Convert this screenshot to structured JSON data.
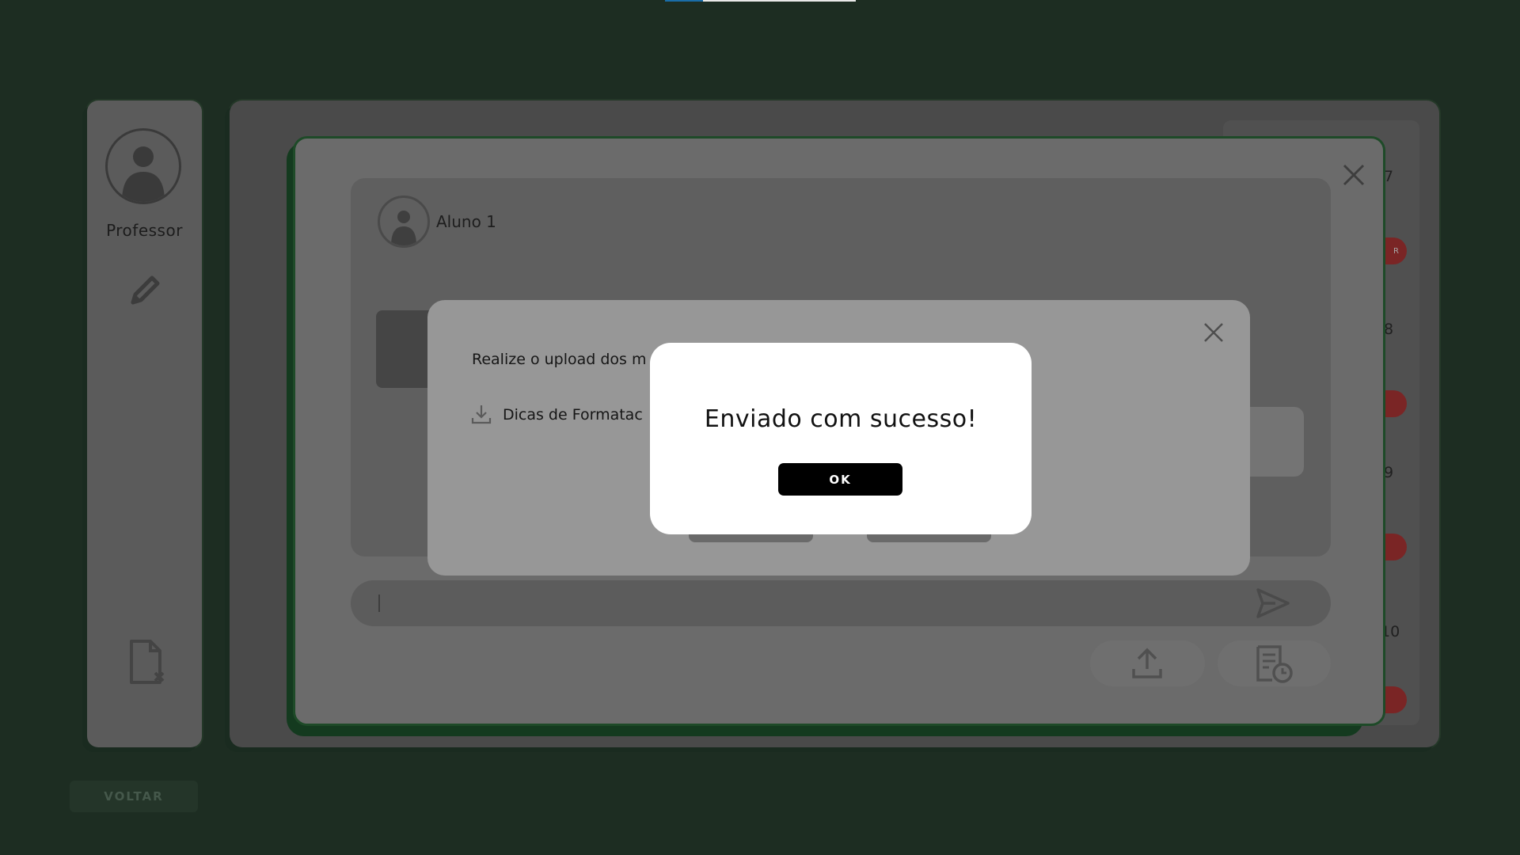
{
  "sidebar": {
    "profile_label": "Professor",
    "icons": [
      "user-avatar-icon",
      "pencil-icon",
      "document-icon"
    ]
  },
  "footer": {
    "back_label": "VOLTAR"
  },
  "right_column": {
    "numbers": [
      "7",
      "8",
      "9",
      "10"
    ],
    "badge_label": "R"
  },
  "chat": {
    "student_name": "Aluno 1",
    "message_input_value": ""
  },
  "upload_dialog": {
    "instruction": "Realize o upload dos m",
    "tips_link": "Dicas de Formatac"
  },
  "success_dialog": {
    "title": "Enviado com sucesso!",
    "ok_label": "OK"
  },
  "colors": {
    "background": "#1d2d22",
    "ok_button": "#000000",
    "badge": "#7a2525",
    "progress": "#1a6da8"
  }
}
